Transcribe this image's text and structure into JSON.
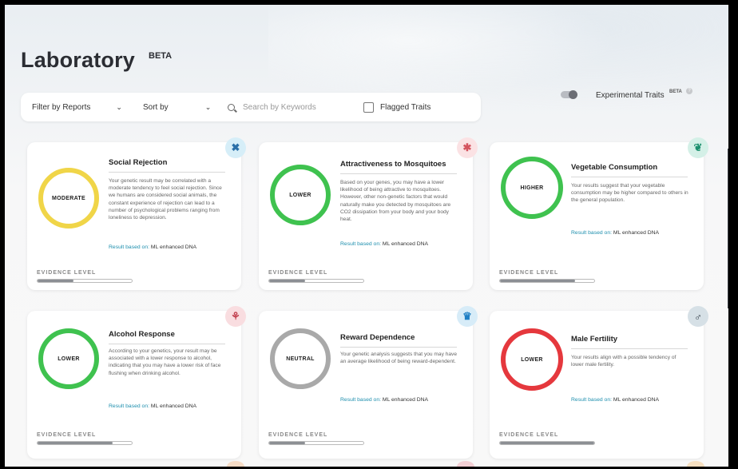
{
  "page": {
    "title": "Laboratory",
    "beta": "BETA"
  },
  "filters": {
    "filter_by": "Filter by Reports",
    "sort_by": "Sort by",
    "search_placeholder": "Search by Keywords",
    "flagged": "Flagged Traits"
  },
  "experimental": {
    "label": "Experimental Traits",
    "beta": "BETA",
    "toggle_on": true,
    "info": "?"
  },
  "cards": [
    {
      "title": "Social Rejection",
      "level": "MODERATE",
      "ring_color": "#f0d548",
      "desc": "Your genetic result may be correlated with a moderate tendency to feel social rejection. Since we humans are considered social animals, the constant experience of rejection can lead to a number of psychological problems ranging from loneliness to depression.",
      "result_prefix": "Result based on:",
      "result_source": "ML enhanced DNA",
      "evidence_label": "EVIDENCE LEVEL",
      "evidence": 0.38,
      "icon": "chat-bubble-icon",
      "icon_glyph": "✖",
      "icon_color": "#2a6fa8",
      "icon_bg": "#d6eef8"
    },
    {
      "title": "Attractiveness to Mosquitoes",
      "level": "LOWER",
      "ring_color": "#3fc24f",
      "desc": "Based on your genes, you may have a lower likelihood of being attractive to mosquitoes. However, other non-genetic factors that would naturally make you detected by mosquitoes are CO2 dissipation from your body and your body heat.",
      "result_prefix": "Result based on:",
      "result_source": "ML enhanced DNA",
      "evidence_label": "EVIDENCE LEVEL",
      "evidence": 0.38,
      "icon": "mosquito-icon",
      "icon_glyph": "✱",
      "icon_color": "#d4535e",
      "icon_bg": "#fbe2e4"
    },
    {
      "title": "Vegetable Consumption",
      "level": "HIGHER",
      "ring_color": "#3fc24f",
      "desc": "Your results suggest that your vegetable consumption may be higher compared to others in the general population.",
      "result_prefix": "Result based on:",
      "result_source": "ML enhanced DNA",
      "evidence_label": "EVIDENCE LEVEL",
      "evidence": 0.8,
      "icon": "leaf-icon",
      "icon_glyph": "❦",
      "icon_color": "#1c8f6e",
      "icon_bg": "#d4f0e7"
    },
    {
      "title": "Alcohol Response",
      "level": "LOWER",
      "ring_color": "#3fc24f",
      "desc": "According to your genetics, your result may be associated with a lower response to alcohol, indicating that you may have a lower risk of face flushing when drinking alcohol.",
      "result_prefix": "Result based on:",
      "result_source": "ML enhanced DNA",
      "evidence_label": "EVIDENCE LEVEL",
      "evidence": 0.8,
      "icon": "wine-glasses-icon",
      "icon_glyph": "⚘",
      "icon_color": "#c2404f",
      "icon_bg": "#f9dde0"
    },
    {
      "title": "Reward Dependence",
      "level": "NEUTRAL",
      "ring_color": "#a9a9a9",
      "desc": "Your genetic analysis suggests that you may have an average likelihood of being reward-dependent.",
      "result_prefix": "Result based on:",
      "result_source": "ML enhanced DNA",
      "evidence_label": "EVIDENCE LEVEL",
      "evidence": 0.38,
      "icon": "trophy-icon",
      "icon_glyph": "♛",
      "icon_color": "#1f7fc4",
      "icon_bg": "#d7ecf8"
    },
    {
      "title": "Male Fertility",
      "level": "LOWER",
      "ring_color": "#e5383d",
      "desc": "Your results align with a possible tendency of lower male fertility.",
      "result_prefix": "Result based on:",
      "result_source": "ML enhanced DNA",
      "evidence_label": "EVIDENCE LEVEL",
      "evidence": 1.0,
      "icon": "sperm-icon",
      "icon_glyph": "♂",
      "icon_color": "#2f3a44",
      "icon_bg": "#d6e0e6"
    }
  ]
}
